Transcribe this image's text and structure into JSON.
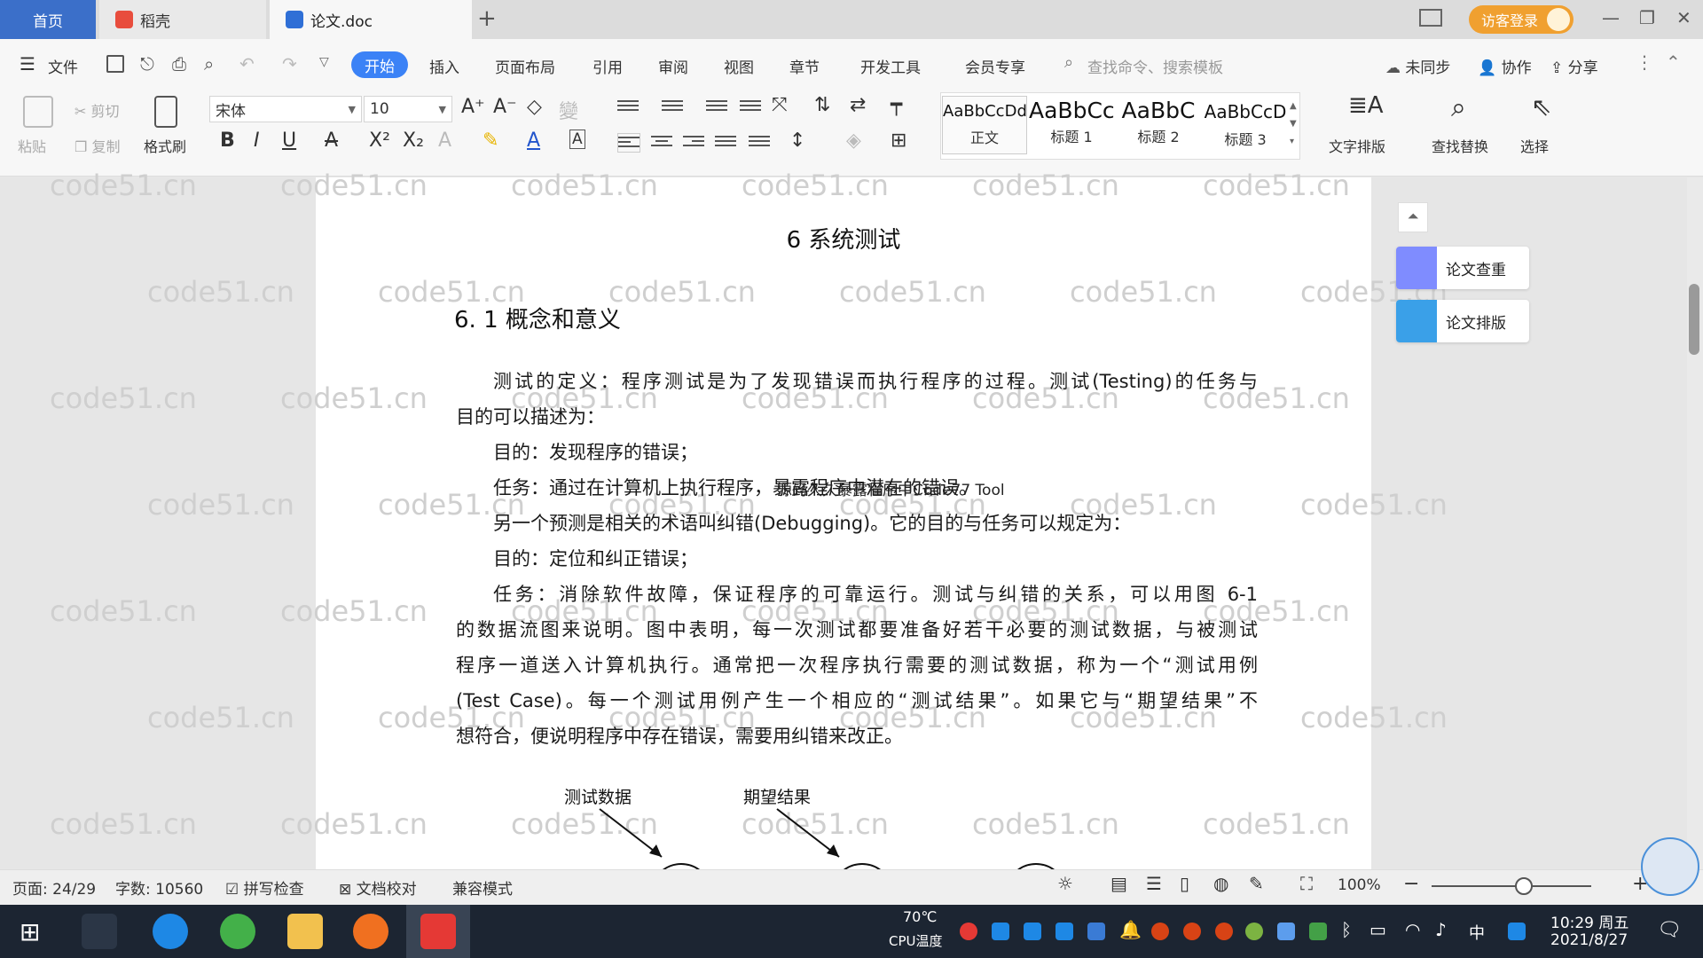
{
  "tabs": {
    "home": "首页",
    "wps": "稻壳",
    "doc": "论文.doc",
    "add": "+"
  },
  "header_right": {
    "login": "访客登录"
  },
  "menu": {
    "file": "文件",
    "items": [
      "开始",
      "插入",
      "页面布局",
      "引用",
      "审阅",
      "视图",
      "章节",
      "开发工具",
      "会员专享"
    ],
    "search_placeholder": "查找命令、搜索模板",
    "sync": "未同步",
    "collab": "协作",
    "share": "分享"
  },
  "ribbon": {
    "paste": "粘贴",
    "cut": "剪切",
    "copy": "复制",
    "format_painter": "格式刷",
    "font_name": "宋体",
    "font_size": "10",
    "styles": [
      {
        "sample": "AaBbCcDd",
        "name": "正文"
      },
      {
        "sample": "AaBbCc",
        "name": "标题 1"
      },
      {
        "sample": "AaBbC",
        "name": "标题 2"
      },
      {
        "sample": "AaBbCcD",
        "name": "标题 3"
      }
    ],
    "text_layout": "文字排版",
    "find_replace": "查找替换",
    "select": "选择"
  },
  "document": {
    "watermark": "code51.cn",
    "title": "6 系统测试",
    "h2": "6. 1 概念和意义",
    "paragraphs": [
      "测试的定义：程序测试是为了发现错误而执行程序的过程。测试(Testing)的任务与",
      "目的可以描述为：",
      "目的：发现程序的错误；",
      "任务：通过在计算机上执行程序，暴露程序中潜在的错误。",
      "另一个预测是相关的术语叫纠错(Debugging)。它的目的与任务可以规定为：",
      "目的：定位和纠正错误；",
      "任务：消除软件故障，保证程序的可靠运行。测试与纠错的关系，可以用图 6-1",
      "的数据流图来说明。图中表明，每一次测试都要准备好若干必要的测试数据，与被测试",
      "程序一道送入计算机执行。通常把一次程序执行需要的测试数据，称为一个“测试用例",
      "(Test Case)。每一个测试用例产生一个相应的“测试结果”。如果它与“期望结果”不",
      "想符合，便说明程序中存在错误，需要用纠错来改正。"
    ],
    "overlap_text": "源码久久暴露程序中Code77 Tool",
    "diagram": {
      "label1": "测试数据",
      "label2": "期望结果"
    }
  },
  "side_panel": {
    "check": "论文查重",
    "layout": "论文排版"
  },
  "status": {
    "page": "页面: 24/29",
    "words": "字数: 10560",
    "spell": "拼写检查",
    "proof": "文档校对",
    "compat": "兼容模式",
    "zoom": "100%"
  },
  "taskbar": {
    "cpu_temp": "70℃",
    "cpu_label": "CPU温度",
    "ime": "中",
    "time": "10:29 周五",
    "date": "2021/8/27"
  },
  "colors": {
    "accent": "#3b82f6",
    "home_tab": "#3b6fc9",
    "login": "#f0a030",
    "taskbar": "#1c2532"
  }
}
